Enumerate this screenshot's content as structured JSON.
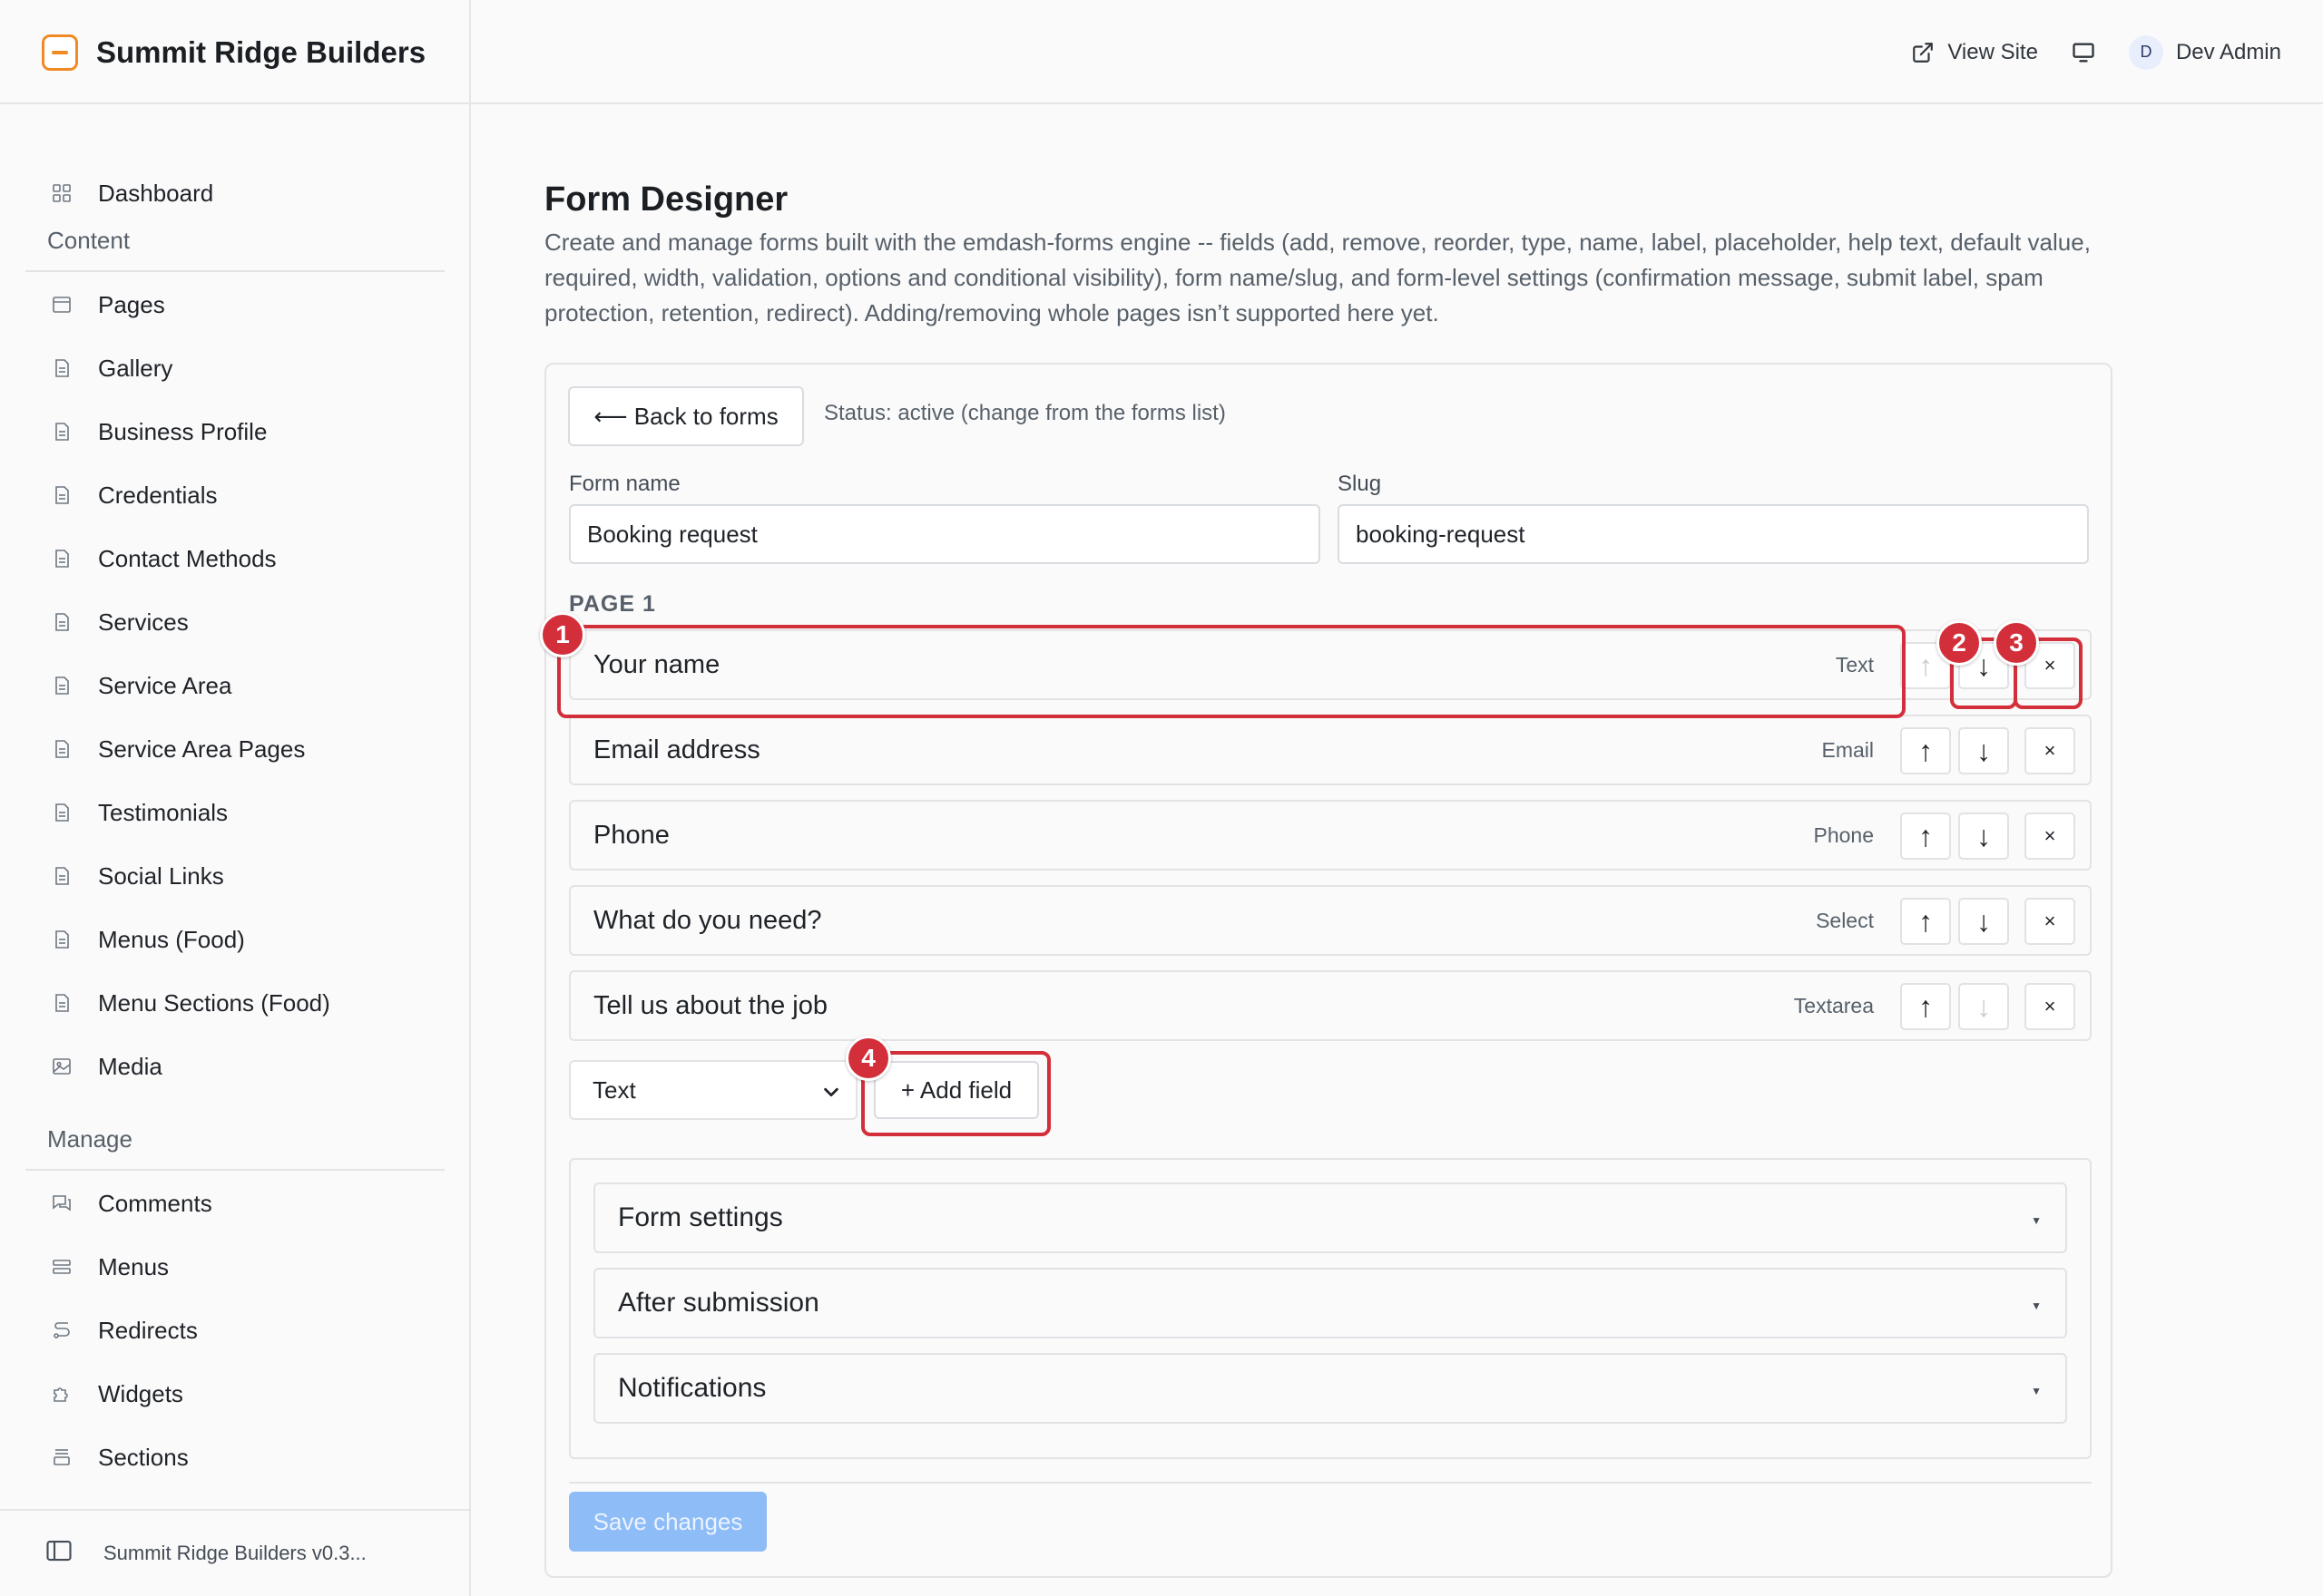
{
  "app": {
    "name": "Summit Ridge Builders",
    "brand_color": "#f08a24",
    "version_label": "Summit Ridge Builders v0.3..."
  },
  "topbar": {
    "view_site": "View Site",
    "user_initial": "D",
    "user_name": "Dev Admin"
  },
  "sidebar": {
    "dashboard": "Dashboard",
    "content_heading": "Content",
    "content_items": [
      {
        "label": "Pages",
        "icon": "page-icon"
      },
      {
        "label": "Gallery",
        "icon": "document-icon"
      },
      {
        "label": "Business Profile",
        "icon": "document-icon"
      },
      {
        "label": "Credentials",
        "icon": "document-icon"
      },
      {
        "label": "Contact Methods",
        "icon": "document-icon"
      },
      {
        "label": "Services",
        "icon": "document-icon"
      },
      {
        "label": "Service Area",
        "icon": "document-icon"
      },
      {
        "label": "Service Area Pages",
        "icon": "document-icon"
      },
      {
        "label": "Testimonials",
        "icon": "document-icon"
      },
      {
        "label": "Social Links",
        "icon": "document-icon"
      },
      {
        "label": "Menus (Food)",
        "icon": "document-icon"
      },
      {
        "label": "Menu Sections (Food)",
        "icon": "document-icon"
      },
      {
        "label": "Media",
        "icon": "image-icon"
      }
    ],
    "manage_heading": "Manage",
    "manage_items": [
      {
        "label": "Comments",
        "icon": "comments-icon"
      },
      {
        "label": "Menus",
        "icon": "menu-icon"
      },
      {
        "label": "Redirects",
        "icon": "redirect-icon"
      },
      {
        "label": "Widgets",
        "icon": "puzzle-icon"
      },
      {
        "label": "Sections",
        "icon": "sections-icon"
      }
    ]
  },
  "main": {
    "title": "Form Designer",
    "description": "Create and manage forms built with the emdash-forms engine -- fields (add, remove, reorder, type, name, label, placeholder, help text, default value, required, width, validation, options and conditional visibility), form name/slug, and form-level settings (confirmation message, submit label, spam protection, retention, redirect). Adding/removing whole pages isn’t supported here yet.",
    "back_button": "⟵ Back to forms",
    "status_text": "Status: active (change from the forms list)",
    "form_name_label": "Form name",
    "form_name_value": "Booking request",
    "slug_label": "Slug",
    "slug_value": "booking-request",
    "page_label": "PAGE 1",
    "fields": [
      {
        "name": "Your name",
        "type": "Text",
        "can_move_up": false,
        "can_move_down": true
      },
      {
        "name": "Email address",
        "type": "Email",
        "can_move_up": true,
        "can_move_down": true
      },
      {
        "name": "Phone",
        "type": "Phone",
        "can_move_up": true,
        "can_move_down": true
      },
      {
        "name": "What do you need?",
        "type": "Select",
        "can_move_up": true,
        "can_move_down": true
      },
      {
        "name": "Tell us about the job",
        "type": "Textarea",
        "can_move_up": true,
        "can_move_down": false
      }
    ],
    "move_up_glyph": "↑",
    "move_down_glyph": "↓",
    "remove_glyph": "×",
    "new_field_type": "Text",
    "add_field_button": "+ Add field",
    "sections": [
      "Form settings",
      "After submission",
      "Notifications"
    ],
    "save_button": "Save changes",
    "save_color": "#8dbcf7"
  },
  "annotations": {
    "color": "#d32f3a",
    "badges": [
      "1",
      "2",
      "3",
      "4"
    ]
  }
}
